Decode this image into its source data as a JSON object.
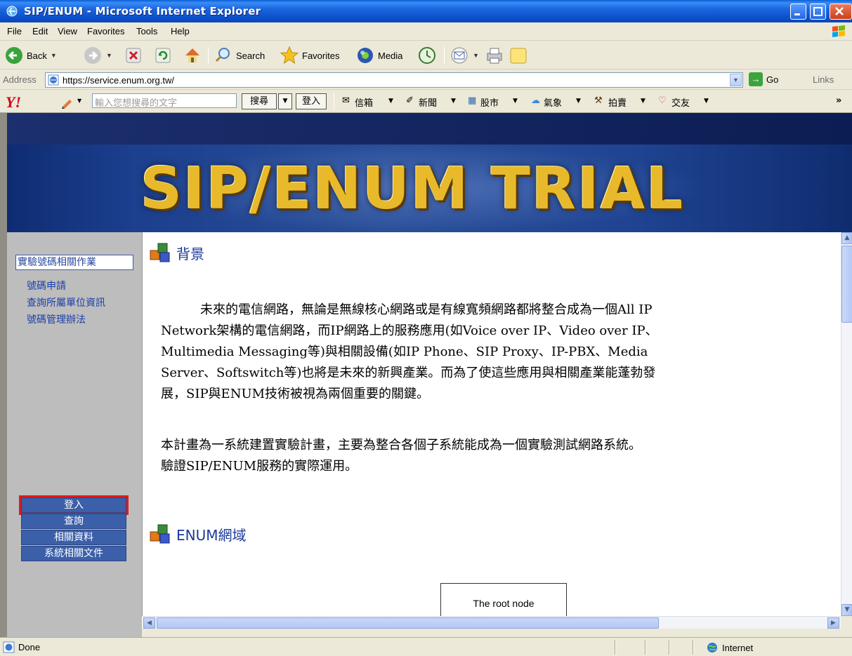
{
  "window": {
    "title": "SIP/ENUM - Microsoft Internet Explorer"
  },
  "menu": [
    "File",
    "Edit",
    "View",
    "Favorites",
    "Tools",
    "Help"
  ],
  "toolbar": {
    "back_label": "Back",
    "search_label": "Search",
    "favorites_label": "Favorites",
    "media_label": "Media"
  },
  "address": {
    "label": "Address",
    "url": "https://service.enum.org.tw/",
    "go_label": "Go",
    "links_label": "Links"
  },
  "yahoo": {
    "logo": "Y!",
    "search_placeholder": "輸入您想搜尋的文字",
    "search_button": "搜尋",
    "login_button": "登入",
    "items": [
      "信箱",
      "新聞",
      "股市",
      "氣象",
      "拍賣",
      "交友"
    ],
    "more": "»"
  },
  "banner": {
    "title": "SIP/ENUM TRIAL"
  },
  "sidebar": {
    "heading": "實驗號碼相關作業",
    "links": [
      "號碼申請",
      "查詢所屬單位資訊",
      "號碼管理辦法"
    ],
    "buttons": [
      "登入",
      "查詢",
      "相關資料",
      "系統相關文件"
    ]
  },
  "content": {
    "section1_title": "背景",
    "para1_line1": "未來的電信網路，無論是無線核心網路或是有線寬頻網路都將整合成為一個All IP",
    "para1_line2": "Network架構的電信網路，而IP網路上的服務應用(如Voice over IP、Video over IP、",
    "para1_line3": "Multimedia Messaging等)與相關設備(如IP Phone、SIP Proxy、IP-PBX、Media",
    "para1_line4": "Server、Softswitch等)也將是未來的新興產業。而為了使這些應用與相關產業能蓬勃發",
    "para1_line5": "展，SIP與ENUM技術被視為兩個重要的關鍵。",
    "para2_line1": "本計畫為一系統建置實驗計畫，主要為整合各個子系統能成為一個實驗測試網路系統。",
    "para2_line2": "驗證SIP/ENUM服務的實際運用。",
    "section2_title": "ENUM網域",
    "diagram_root": "The root node"
  },
  "status": {
    "text": "Done",
    "zone": "Internet"
  }
}
